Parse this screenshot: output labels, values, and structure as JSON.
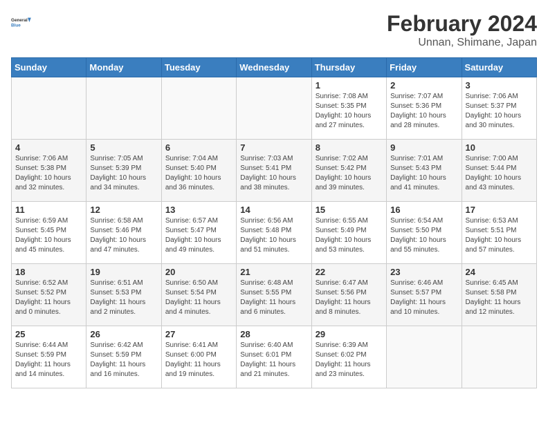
{
  "header": {
    "logo_line1": "General",
    "logo_line2": "Blue",
    "title": "February 2024",
    "subtitle": "Unnan, Shimane, Japan"
  },
  "weekdays": [
    "Sunday",
    "Monday",
    "Tuesday",
    "Wednesday",
    "Thursday",
    "Friday",
    "Saturday"
  ],
  "weeks": [
    [
      {
        "day": "",
        "info": ""
      },
      {
        "day": "",
        "info": ""
      },
      {
        "day": "",
        "info": ""
      },
      {
        "day": "",
        "info": ""
      },
      {
        "day": "1",
        "info": "Sunrise: 7:08 AM\nSunset: 5:35 PM\nDaylight: 10 hours\nand 27 minutes."
      },
      {
        "day": "2",
        "info": "Sunrise: 7:07 AM\nSunset: 5:36 PM\nDaylight: 10 hours\nand 28 minutes."
      },
      {
        "day": "3",
        "info": "Sunrise: 7:06 AM\nSunset: 5:37 PM\nDaylight: 10 hours\nand 30 minutes."
      }
    ],
    [
      {
        "day": "4",
        "info": "Sunrise: 7:06 AM\nSunset: 5:38 PM\nDaylight: 10 hours\nand 32 minutes."
      },
      {
        "day": "5",
        "info": "Sunrise: 7:05 AM\nSunset: 5:39 PM\nDaylight: 10 hours\nand 34 minutes."
      },
      {
        "day": "6",
        "info": "Sunrise: 7:04 AM\nSunset: 5:40 PM\nDaylight: 10 hours\nand 36 minutes."
      },
      {
        "day": "7",
        "info": "Sunrise: 7:03 AM\nSunset: 5:41 PM\nDaylight: 10 hours\nand 38 minutes."
      },
      {
        "day": "8",
        "info": "Sunrise: 7:02 AM\nSunset: 5:42 PM\nDaylight: 10 hours\nand 39 minutes."
      },
      {
        "day": "9",
        "info": "Sunrise: 7:01 AM\nSunset: 5:43 PM\nDaylight: 10 hours\nand 41 minutes."
      },
      {
        "day": "10",
        "info": "Sunrise: 7:00 AM\nSunset: 5:44 PM\nDaylight: 10 hours\nand 43 minutes."
      }
    ],
    [
      {
        "day": "11",
        "info": "Sunrise: 6:59 AM\nSunset: 5:45 PM\nDaylight: 10 hours\nand 45 minutes."
      },
      {
        "day": "12",
        "info": "Sunrise: 6:58 AM\nSunset: 5:46 PM\nDaylight: 10 hours\nand 47 minutes."
      },
      {
        "day": "13",
        "info": "Sunrise: 6:57 AM\nSunset: 5:47 PM\nDaylight: 10 hours\nand 49 minutes."
      },
      {
        "day": "14",
        "info": "Sunrise: 6:56 AM\nSunset: 5:48 PM\nDaylight: 10 hours\nand 51 minutes."
      },
      {
        "day": "15",
        "info": "Sunrise: 6:55 AM\nSunset: 5:49 PM\nDaylight: 10 hours\nand 53 minutes."
      },
      {
        "day": "16",
        "info": "Sunrise: 6:54 AM\nSunset: 5:50 PM\nDaylight: 10 hours\nand 55 minutes."
      },
      {
        "day": "17",
        "info": "Sunrise: 6:53 AM\nSunset: 5:51 PM\nDaylight: 10 hours\nand 57 minutes."
      }
    ],
    [
      {
        "day": "18",
        "info": "Sunrise: 6:52 AM\nSunset: 5:52 PM\nDaylight: 11 hours\nand 0 minutes."
      },
      {
        "day": "19",
        "info": "Sunrise: 6:51 AM\nSunset: 5:53 PM\nDaylight: 11 hours\nand 2 minutes."
      },
      {
        "day": "20",
        "info": "Sunrise: 6:50 AM\nSunset: 5:54 PM\nDaylight: 11 hours\nand 4 minutes."
      },
      {
        "day": "21",
        "info": "Sunrise: 6:48 AM\nSunset: 5:55 PM\nDaylight: 11 hours\nand 6 minutes."
      },
      {
        "day": "22",
        "info": "Sunrise: 6:47 AM\nSunset: 5:56 PM\nDaylight: 11 hours\nand 8 minutes."
      },
      {
        "day": "23",
        "info": "Sunrise: 6:46 AM\nSunset: 5:57 PM\nDaylight: 11 hours\nand 10 minutes."
      },
      {
        "day": "24",
        "info": "Sunrise: 6:45 AM\nSunset: 5:58 PM\nDaylight: 11 hours\nand 12 minutes."
      }
    ],
    [
      {
        "day": "25",
        "info": "Sunrise: 6:44 AM\nSunset: 5:59 PM\nDaylight: 11 hours\nand 14 minutes."
      },
      {
        "day": "26",
        "info": "Sunrise: 6:42 AM\nSunset: 5:59 PM\nDaylight: 11 hours\nand 16 minutes."
      },
      {
        "day": "27",
        "info": "Sunrise: 6:41 AM\nSunset: 6:00 PM\nDaylight: 11 hours\nand 19 minutes."
      },
      {
        "day": "28",
        "info": "Sunrise: 6:40 AM\nSunset: 6:01 PM\nDaylight: 11 hours\nand 21 minutes."
      },
      {
        "day": "29",
        "info": "Sunrise: 6:39 AM\nSunset: 6:02 PM\nDaylight: 11 hours\nand 23 minutes."
      },
      {
        "day": "",
        "info": ""
      },
      {
        "day": "",
        "info": ""
      }
    ]
  ]
}
